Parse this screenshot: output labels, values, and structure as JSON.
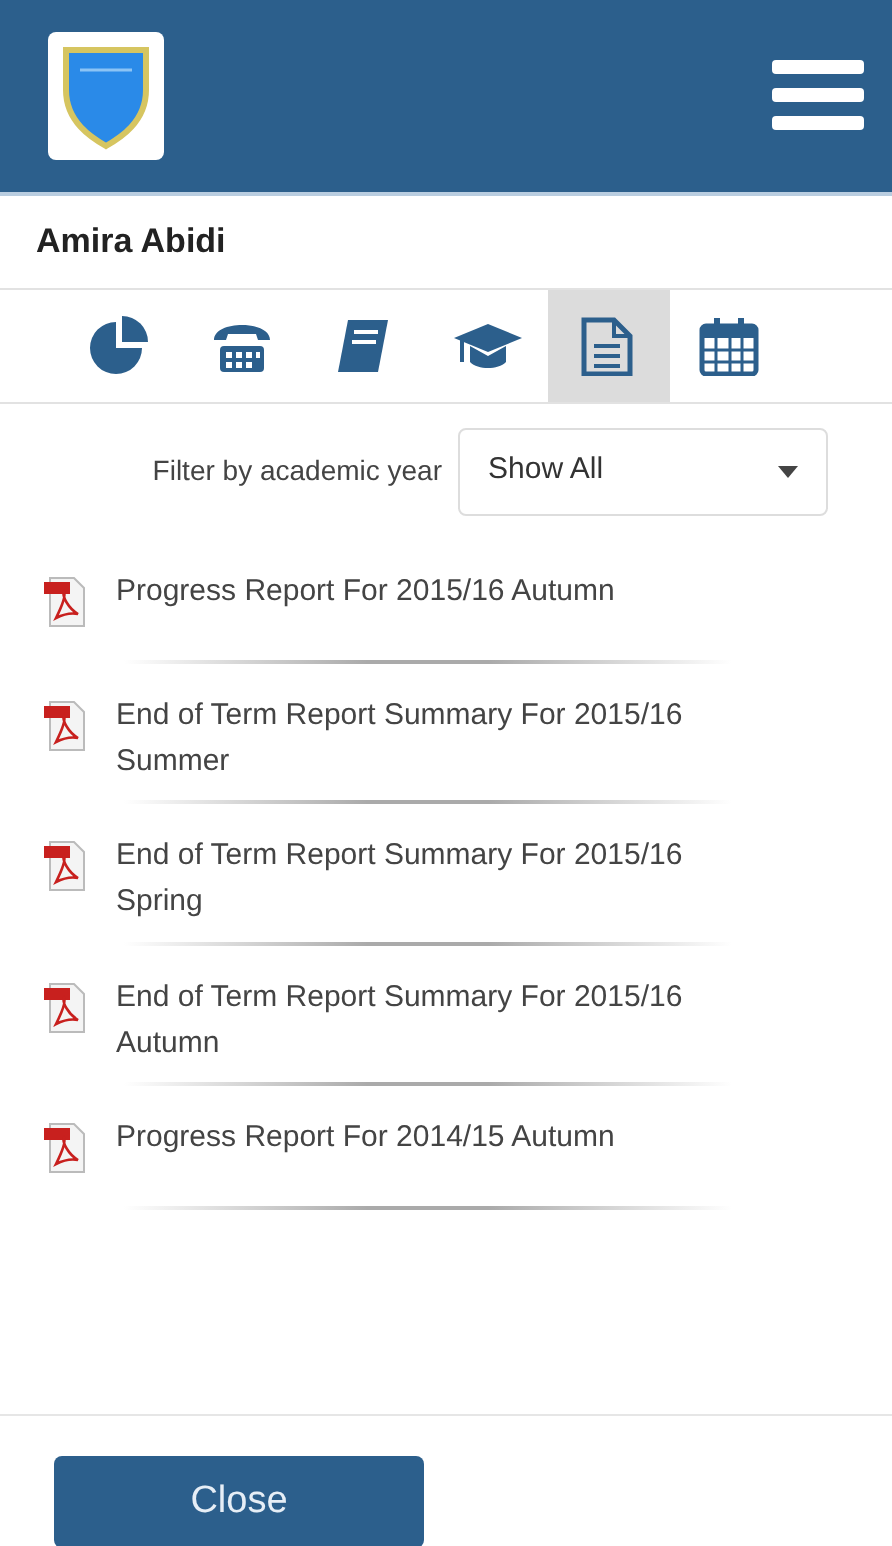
{
  "student": {
    "name": "Amira Abidi"
  },
  "tabs": [
    {
      "kind": "pie",
      "selected": false
    },
    {
      "kind": "phone",
      "selected": false
    },
    {
      "kind": "book",
      "selected": false
    },
    {
      "kind": "cap",
      "selected": false
    },
    {
      "kind": "document",
      "selected": true
    },
    {
      "kind": "calendar",
      "selected": false
    }
  ],
  "filter": {
    "label": "Filter by academic year",
    "value": "Show All"
  },
  "reports": [
    {
      "title": "Progress Report For 2015/16 Autumn"
    },
    {
      "title": "End of Term Report Summary For 2015/16 Summer"
    },
    {
      "title": "End of Term Report Summary For 2015/16 Spring"
    },
    {
      "title": "End of Term Report Summary For 2015/16 Autumn"
    },
    {
      "title": "Progress Report For 2014/15 Autumn"
    }
  ],
  "buttons": [
    "Close"
  ]
}
